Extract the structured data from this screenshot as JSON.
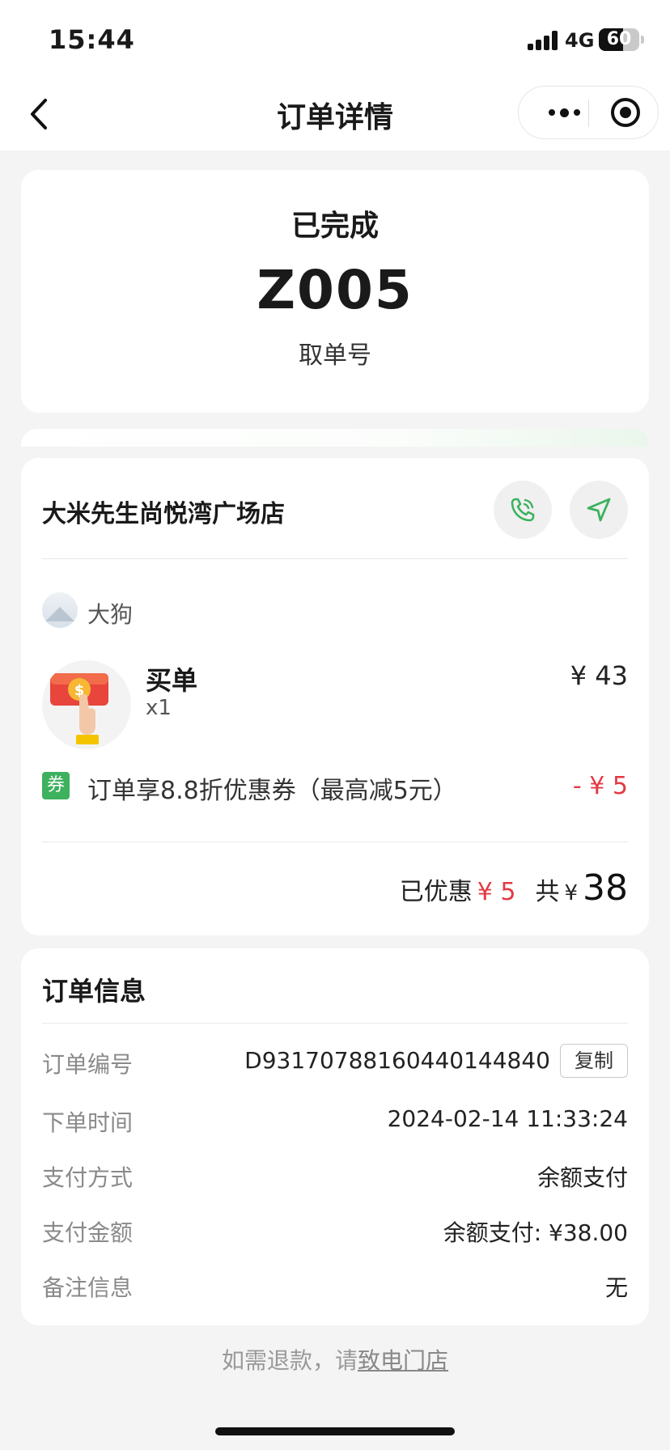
{
  "status_bar": {
    "time": "15:44",
    "network": "4G",
    "battery": "60",
    "battery_level": 0.6
  },
  "nav": {
    "title": "订单详情"
  },
  "order_status": {
    "status": "已完成",
    "pickup_code": "Z005",
    "pickup_label": "取单号"
  },
  "store": {
    "name": "大米先生尚悦湾广场店",
    "user_name": "大狗",
    "item": {
      "name": "买单",
      "qty": "x1",
      "price": "¥ 43"
    },
    "coupon": {
      "tag": "券",
      "text": "订单享8.8折优惠券（最高减5元）",
      "amount": "- ¥ 5"
    },
    "totals": {
      "discount_label": "已优惠",
      "discount": "¥ 5",
      "total_label": "共",
      "currency": "¥",
      "total": "38"
    }
  },
  "order_info": {
    "title": "订单信息",
    "rows": [
      {
        "key": "订单编号",
        "value": "D93170788160440144840"
      },
      {
        "key": "下单时间",
        "value": "2024-02-14 11:33:24"
      },
      {
        "key": "支付方式",
        "value": "余额支付"
      },
      {
        "key": "支付金额",
        "value": "余额支付: ¥38.00"
      },
      {
        "key": "备注信息",
        "value": "无"
      }
    ],
    "copy_label": "复制"
  },
  "footer": {
    "prefix": "如需退款，请",
    "link": "致电门店"
  },
  "colors": {
    "accent_green": "#3db15e",
    "price_red": "#e23a43"
  },
  "icons": {
    "back": "chevron-left-icon",
    "more": "more-dots-icon",
    "target": "target-icon",
    "phone": "phone-icon",
    "navigate": "navigation-arrow-icon"
  }
}
